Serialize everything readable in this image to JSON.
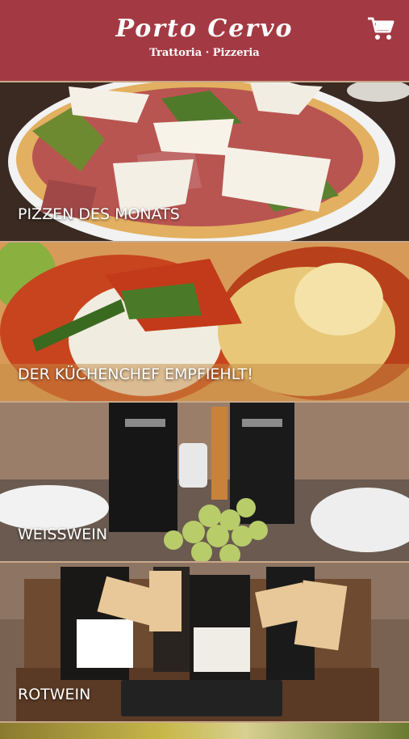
{
  "header": {
    "brand": "Porto Cervo",
    "tagline": "Trattoria · Pizzeria",
    "cart_icon": "cart-icon",
    "background": "#a33a43"
  },
  "categories": [
    {
      "label": "PIZZEN DES MONATS"
    },
    {
      "label": "DER KÜCHENCHEF EMPFIEHLT!"
    },
    {
      "label": "WEISSWEIN"
    },
    {
      "label": "ROTWEIN"
    }
  ]
}
